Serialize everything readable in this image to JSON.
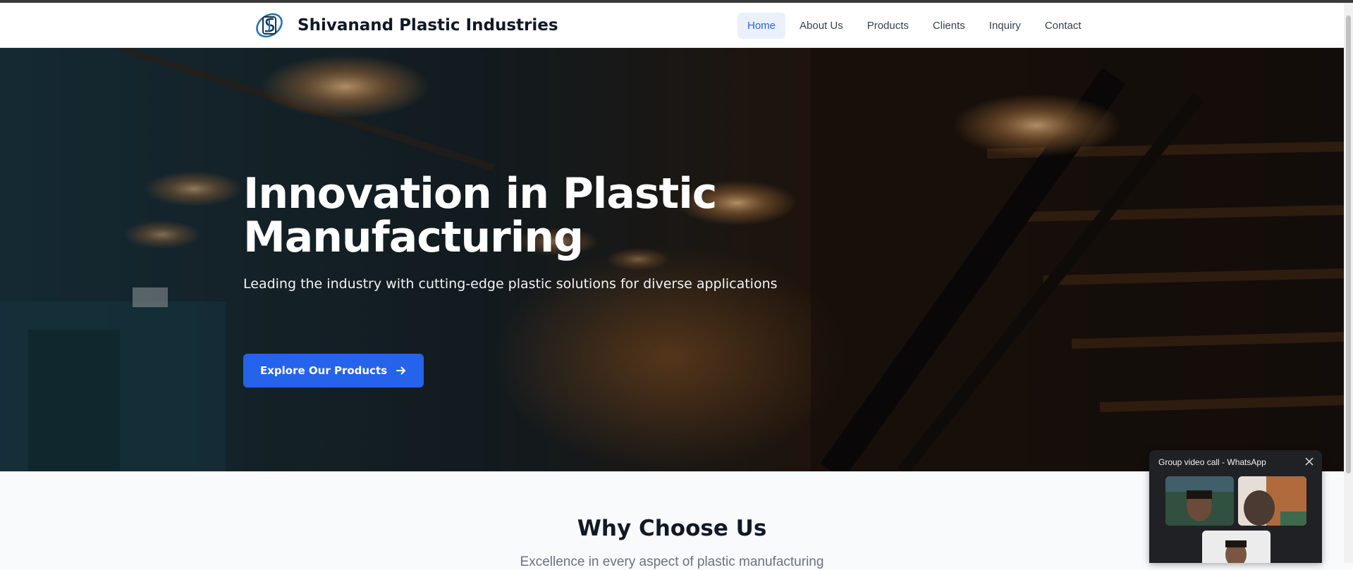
{
  "brand": {
    "name": "Shivanand Plastic Industries",
    "logo_icon": "sp-logo-icon"
  },
  "nav": {
    "items": [
      {
        "label": "Home",
        "active": true
      },
      {
        "label": "About Us",
        "active": false
      },
      {
        "label": "Products",
        "active": false
      },
      {
        "label": "Clients",
        "active": false
      },
      {
        "label": "Inquiry",
        "active": false
      },
      {
        "label": "Contact",
        "active": false
      }
    ]
  },
  "hero": {
    "title_line1": "Innovation in Plastic",
    "title_line2": "Manufacturing",
    "subtitle": "Leading the industry with cutting-edge plastic solutions for diverse applications",
    "cta_label": "Explore Our Products",
    "cta_icon": "arrow-right-icon"
  },
  "why": {
    "title": "Why Choose Us",
    "subtitle": "Excellence in every aspect of plastic manufacturing"
  },
  "whatsapp_popup": {
    "title": "Group video call - WhatsApp",
    "close_icon": "close-icon"
  },
  "colors": {
    "accent": "#2563eb",
    "nav_active_bg": "#eaf1fb",
    "heading": "#111827",
    "muted": "#6b7280"
  }
}
